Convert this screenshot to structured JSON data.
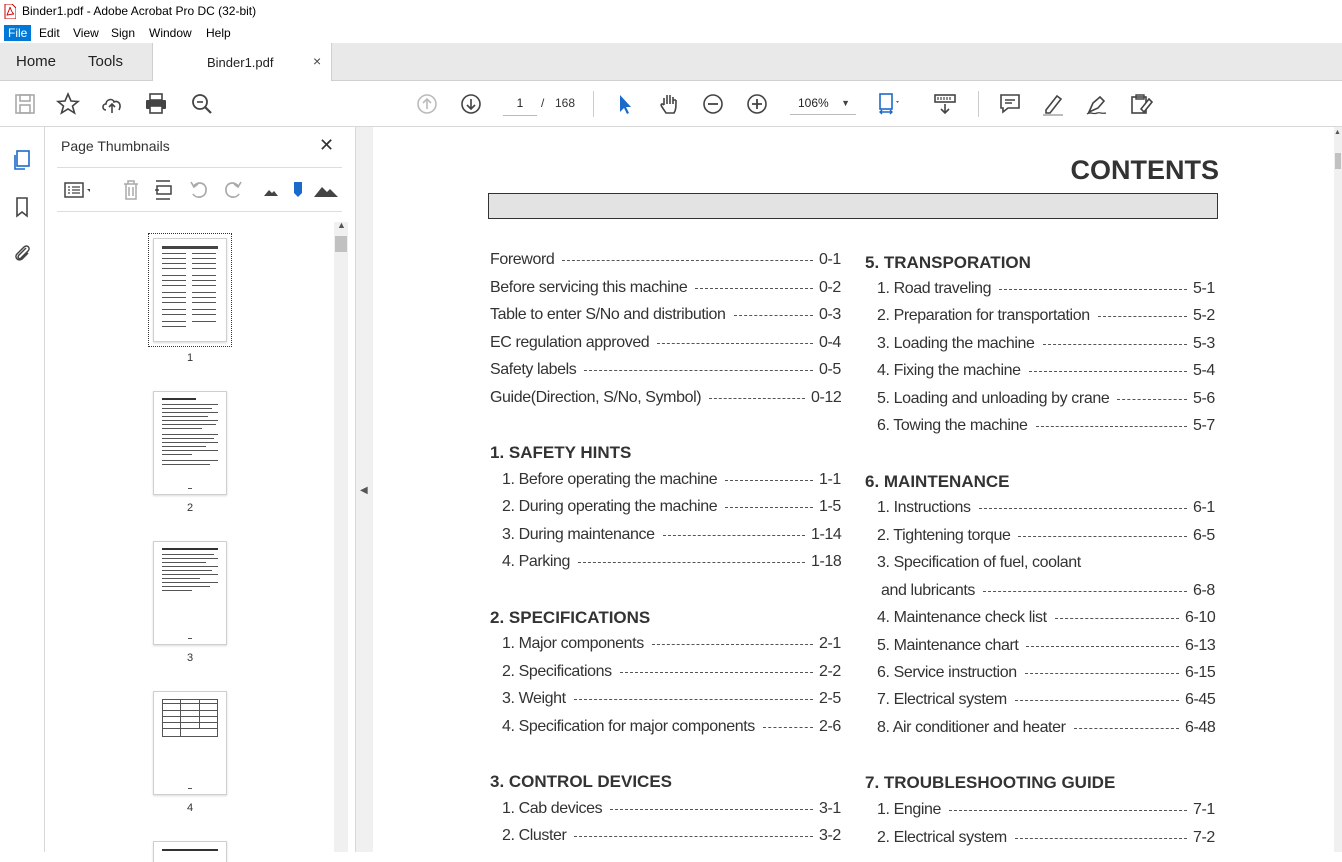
{
  "window": {
    "title": "Binder1.pdf - Adobe Acrobat Pro DC (32-bit)"
  },
  "menu": [
    "File",
    "Edit",
    "View",
    "Sign",
    "Window",
    "Help"
  ],
  "tabs": {
    "home": "Home",
    "tools": "Tools",
    "document": "Binder1.pdf",
    "close": "×"
  },
  "toolbar": {
    "page_current": "1",
    "page_sep": "/",
    "page_total": "168",
    "zoom": "106%"
  },
  "thumbnails": {
    "title": "Page Thumbnails",
    "close": "✕",
    "pages": [
      "1",
      "2",
      "3",
      "4"
    ]
  },
  "document": {
    "heading": "CONTENTS",
    "left_column": [
      {
        "type": "row",
        "label": "Foreword",
        "page": "0-1"
      },
      {
        "type": "row",
        "label": "Before servicing this machine",
        "page": "0-2"
      },
      {
        "type": "row",
        "label": "Table to enter S/No and distribution",
        "page": "0-3"
      },
      {
        "type": "row",
        "label": "EC regulation approved",
        "page": "0-4"
      },
      {
        "type": "row",
        "label": "Safety labels",
        "page": "0-5"
      },
      {
        "type": "row",
        "label": "Guide(Direction, S/No, Symbol)",
        "page": "0-12"
      },
      {
        "type": "section",
        "label": "1. SAFETY HINTS"
      },
      {
        "type": "row",
        "label": "1. Before operating the machine",
        "page": "1-1"
      },
      {
        "type": "row",
        "label": "2. During operating the machine",
        "page": "1-5"
      },
      {
        "type": "row",
        "label": "3. During maintenance",
        "page": "1-14"
      },
      {
        "type": "row",
        "label": "4. Parking",
        "page": "1-18"
      },
      {
        "type": "section",
        "label": "2. SPECIFICATIONS"
      },
      {
        "type": "row",
        "label": "1. Major components",
        "page": "2-1"
      },
      {
        "type": "row",
        "label": "2. Specifications",
        "page": "2-2"
      },
      {
        "type": "row",
        "label": "3. Weight",
        "page": "2-5"
      },
      {
        "type": "row",
        "label": "4. Specification for major components",
        "page": "2-6"
      },
      {
        "type": "section",
        "label": "3. CONTROL DEVICES"
      },
      {
        "type": "row",
        "label": "1. Cab devices",
        "page": "3-1"
      },
      {
        "type": "row",
        "label": "2. Cluster",
        "page": "3-2"
      }
    ],
    "right_column": [
      {
        "type": "section",
        "label": "5. TRANSPORATION"
      },
      {
        "type": "row",
        "label": "1. Road traveling",
        "page": "5-1"
      },
      {
        "type": "row",
        "label": "2. Preparation for transportation",
        "page": "5-2"
      },
      {
        "type": "row",
        "label": "3. Loading the machine",
        "page": "5-3"
      },
      {
        "type": "row",
        "label": "4. Fixing the machine",
        "page": "5-4"
      },
      {
        "type": "row",
        "label": "5. Loading and unloading by crane",
        "page": "5-6"
      },
      {
        "type": "row",
        "label": "6. Towing the machine",
        "page": "5-7"
      },
      {
        "type": "section",
        "label": "6. MAINTENANCE"
      },
      {
        "type": "row",
        "label": "1. Instructions",
        "page": "6-1"
      },
      {
        "type": "row",
        "label": "2. Tightening torque",
        "page": "6-5"
      },
      {
        "type": "text",
        "label": "3. Specification of fuel, coolant"
      },
      {
        "type": "row",
        "label": "and lubricants",
        "page": "6-8"
      },
      {
        "type": "row",
        "label": "4. Maintenance check list",
        "page": "6-10"
      },
      {
        "type": "row",
        "label": "5. Maintenance chart",
        "page": "6-13"
      },
      {
        "type": "row",
        "label": "6. Service instruction",
        "page": "6-15"
      },
      {
        "type": "row",
        "label": "7. Electrical system",
        "page": "6-45"
      },
      {
        "type": "row",
        "label": "8. Air conditioner and heater",
        "page": "6-48"
      },
      {
        "type": "section",
        "label": "7. TROUBLESHOOTING GUIDE"
      },
      {
        "type": "row",
        "label": "1. Engine",
        "page": "7-1"
      },
      {
        "type": "row",
        "label": "2. Electrical system",
        "page": "7-2"
      }
    ]
  }
}
